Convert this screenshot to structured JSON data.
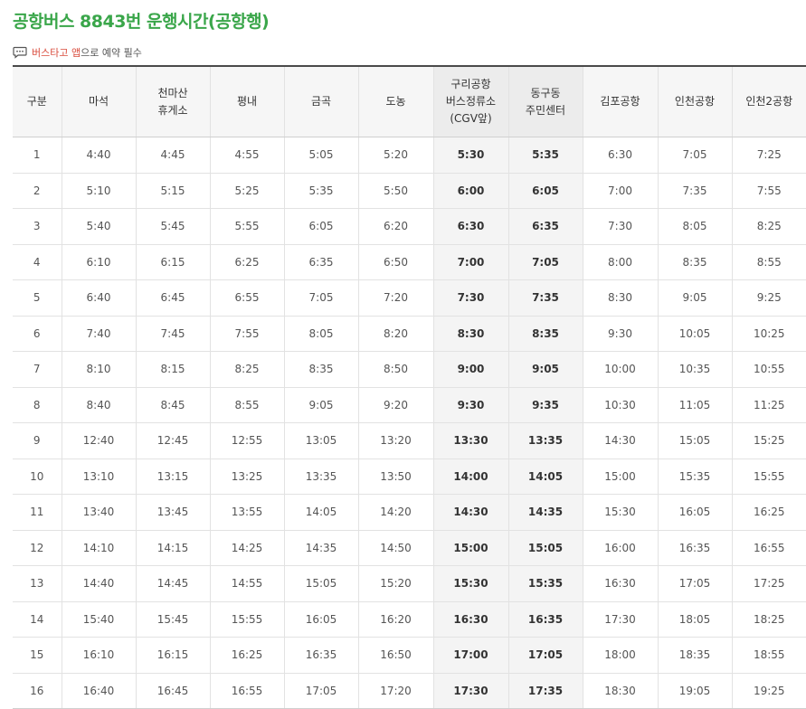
{
  "title": "공항버스 8843번 운행시간(공항행)",
  "notice": {
    "icon": "chat-bubble-icon",
    "highlight": "버스타고 앱",
    "rest": "으로 예약 필수"
  },
  "colors": {
    "title": "#3aa64a",
    "notice_highlight": "#d94b3c",
    "highlight_column": "#f4f4f4"
  },
  "table": {
    "headers": [
      [
        "구분"
      ],
      [
        "마석"
      ],
      [
        "천마산",
        "휴게소"
      ],
      [
        "평내"
      ],
      [
        "금곡"
      ],
      [
        "도농"
      ],
      [
        "구리공항",
        "버스정류소",
        "(CGV앞)"
      ],
      [
        "동구동",
        "주민센터"
      ],
      [
        "김포공항"
      ],
      [
        "인천공항"
      ],
      [
        "인천2공항"
      ]
    ],
    "highlight_columns": [
      6,
      7
    ],
    "rows": [
      [
        "1",
        "4:40",
        "4:45",
        "4:55",
        "5:05",
        "5:20",
        "5:30",
        "5:35",
        "6:30",
        "7:05",
        "7:25"
      ],
      [
        "2",
        "5:10",
        "5:15",
        "5:25",
        "5:35",
        "5:50",
        "6:00",
        "6:05",
        "7:00",
        "7:35",
        "7:55"
      ],
      [
        "3",
        "5:40",
        "5:45",
        "5:55",
        "6:05",
        "6:20",
        "6:30",
        "6:35",
        "7:30",
        "8:05",
        "8:25"
      ],
      [
        "4",
        "6:10",
        "6:15",
        "6:25",
        "6:35",
        "6:50",
        "7:00",
        "7:05",
        "8:00",
        "8:35",
        "8:55"
      ],
      [
        "5",
        "6:40",
        "6:45",
        "6:55",
        "7:05",
        "7:20",
        "7:30",
        "7:35",
        "8:30",
        "9:05",
        "9:25"
      ],
      [
        "6",
        "7:40",
        "7:45",
        "7:55",
        "8:05",
        "8:20",
        "8:30",
        "8:35",
        "9:30",
        "10:05",
        "10:25"
      ],
      [
        "7",
        "8:10",
        "8:15",
        "8:25",
        "8:35",
        "8:50",
        "9:00",
        "9:05",
        "10:00",
        "10:35",
        "10:55"
      ],
      [
        "8",
        "8:40",
        "8:45",
        "8:55",
        "9:05",
        "9:20",
        "9:30",
        "9:35",
        "10:30",
        "11:05",
        "11:25"
      ],
      [
        "9",
        "12:40",
        "12:45",
        "12:55",
        "13:05",
        "13:20",
        "13:30",
        "13:35",
        "14:30",
        "15:05",
        "15:25"
      ],
      [
        "10",
        "13:10",
        "13:15",
        "13:25",
        "13:35",
        "13:50",
        "14:00",
        "14:05",
        "15:00",
        "15:35",
        "15:55"
      ],
      [
        "11",
        "13:40",
        "13:45",
        "13:55",
        "14:05",
        "14:20",
        "14:30",
        "14:35",
        "15:30",
        "16:05",
        "16:25"
      ],
      [
        "12",
        "14:10",
        "14:15",
        "14:25",
        "14:35",
        "14:50",
        "15:00",
        "15:05",
        "16:00",
        "16:35",
        "16:55"
      ],
      [
        "13",
        "14:40",
        "14:45",
        "14:55",
        "15:05",
        "15:20",
        "15:30",
        "15:35",
        "16:30",
        "17:05",
        "17:25"
      ],
      [
        "14",
        "15:40",
        "15:45",
        "15:55",
        "16:05",
        "16:20",
        "16:30",
        "16:35",
        "17:30",
        "18:05",
        "18:25"
      ],
      [
        "15",
        "16:10",
        "16:15",
        "16:25",
        "16:35",
        "16:50",
        "17:00",
        "17:05",
        "18:00",
        "18:35",
        "18:55"
      ],
      [
        "16",
        "16:40",
        "16:45",
        "16:55",
        "17:05",
        "17:20",
        "17:30",
        "17:35",
        "18:30",
        "19:05",
        "19:25"
      ]
    ]
  }
}
